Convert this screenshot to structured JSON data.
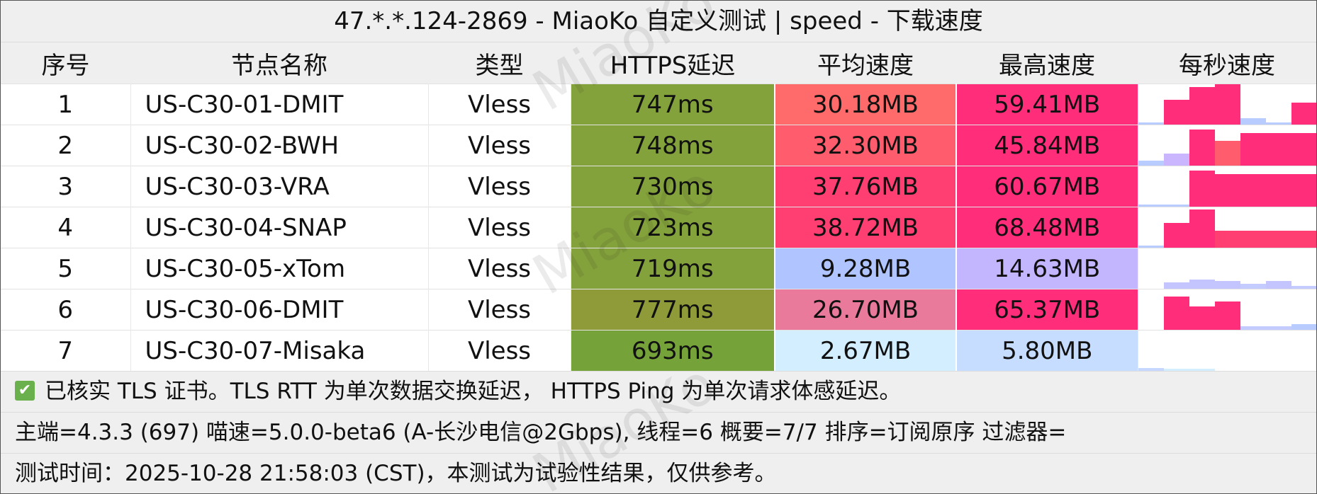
{
  "title": "47.*.*.124-2869 - MiaoKo 自定义测试 | speed - 下载速度",
  "headers": [
    "序号",
    "节点名称",
    "类型",
    "HTTPS延迟",
    "平均速度",
    "最高速度",
    "每秒速度"
  ],
  "rows": [
    {
      "id": "1",
      "name": "US-C30-01-DMIT",
      "type": "Vless",
      "latency": "747ms",
      "avg": "30.18MB",
      "max": "59.41MB",
      "latency_color": "#84a23c",
      "avg_color": "#ff6a6a",
      "max_color": "#ff2d7a"
    },
    {
      "id": "2",
      "name": "US-C30-02-BWH",
      "type": "Vless",
      "latency": "748ms",
      "avg": "32.30MB",
      "max": "45.84MB",
      "latency_color": "#84a23c",
      "avg_color": "#ff5d6d",
      "max_color": "#ff2d7a"
    },
    {
      "id": "3",
      "name": "US-C30-03-VRA",
      "type": "Vless",
      "latency": "730ms",
      "avg": "37.76MB",
      "max": "60.67MB",
      "latency_color": "#84a23c",
      "avg_color": "#ff3f72",
      "max_color": "#ff2d7a"
    },
    {
      "id": "4",
      "name": "US-C30-04-SNAP",
      "type": "Vless",
      "latency": "723ms",
      "avg": "38.72MB",
      "max": "68.48MB",
      "latency_color": "#84a23c",
      "avg_color": "#ff3f72",
      "max_color": "#ff2d7a"
    },
    {
      "id": "5",
      "name": "US-C30-05-xTom",
      "type": "Vless",
      "latency": "719ms",
      "avg": "9.28MB",
      "max": "14.63MB",
      "latency_color": "#84a23c",
      "avg_color": "#b0c4ff",
      "max_color": "#c4b5ff"
    },
    {
      "id": "6",
      "name": "US-C30-06-DMIT",
      "type": "Vless",
      "latency": "777ms",
      "avg": "26.70MB",
      "max": "65.37MB",
      "latency_color": "#8f9a38",
      "avg_color": "#ea7a9c",
      "max_color": "#ff2d7a"
    },
    {
      "id": "7",
      "name": "US-C30-07-Misaka",
      "type": "Vless",
      "latency": "693ms",
      "avg": "2.67MB",
      "max": "5.80MB",
      "latency_color": "#76a23a",
      "avg_color": "#d2eeff",
      "max_color": "#c6ddff"
    }
  ],
  "per_second": [
    [
      0.05,
      0.62,
      0.93,
      1.0,
      0.15,
      0.05,
      0.55
    ],
    [
      0.12,
      0.3,
      0.9,
      0.62,
      0.8,
      0.8,
      0.8
    ],
    [
      0.04,
      0.04,
      0.9,
      0.8,
      0.8,
      0.8,
      0.8
    ],
    [
      0.06,
      0.62,
      0.95,
      0.42,
      0.42,
      0.42,
      0.42
    ],
    [
      0.0,
      0.15,
      0.22,
      0.2,
      0.12,
      0.2,
      0.07
    ],
    [
      0.0,
      0.82,
      0.58,
      0.7,
      0.08,
      0.08,
      0.14
    ],
    [
      0.07,
      0.03,
      0.03,
      0.0,
      0.0,
      0.0,
      0.0
    ]
  ],
  "per_second_colors": [
    [
      "#b8ccff",
      "#ff2d7a",
      "#ff2d7a",
      "#ff2d7a",
      "#b8ccff",
      "#b8ccff",
      "#ff2d7a"
    ],
    [
      "#b8ccff",
      "#c9b6ff",
      "#ff2d7a",
      "#ff5d6d",
      "#ff2d7a",
      "#ff2d7a",
      "#ff2d7a"
    ],
    [
      "#b8ccff",
      "#b8ccff",
      "#ff2d7a",
      "#ff2d7a",
      "#ff2d7a",
      "#ff2d7a",
      "#ff2d7a"
    ],
    [
      "#b8ccff",
      "#ff2d7a",
      "#ff2d7a",
      "#ff3f72",
      "#ff3f72",
      "#ff3f72",
      "#ff3f72"
    ],
    [
      "#b8ccff",
      "#c4c4ff",
      "#c4c4ff",
      "#c4c4ff",
      "#c4ccff",
      "#c4c4ff",
      "#c4ccff"
    ],
    [
      "#b8ccff",
      "#ff2d7a",
      "#ff2d7a",
      "#ff2d7a",
      "#c4ccff",
      "#c4ccff",
      "#b8ccff"
    ],
    [
      "#c6d8ff",
      "#d2eeff",
      "#d2eeff",
      "#ffffff",
      "#ffffff",
      "#ffffff",
      "#ffffff"
    ]
  ],
  "footer": {
    "tls_icon": "check-icon",
    "tls_note": "已核实 TLS 证书。TLS RTT 为单次数据交换延迟， HTTPS Ping 为单次请求体感延迟。",
    "version": "主端=4.3.3 (697) 喵速=5.0.0-beta6 (A-长沙电信@2Gbps), 线程=6 概要=7/7 排序=订阅原序 过滤器=",
    "time": "测试时间：2025-10-28 21:58:03 (CST)，本测试为试验性结果，仅供参考。"
  },
  "watermark": "MiaoKo"
}
